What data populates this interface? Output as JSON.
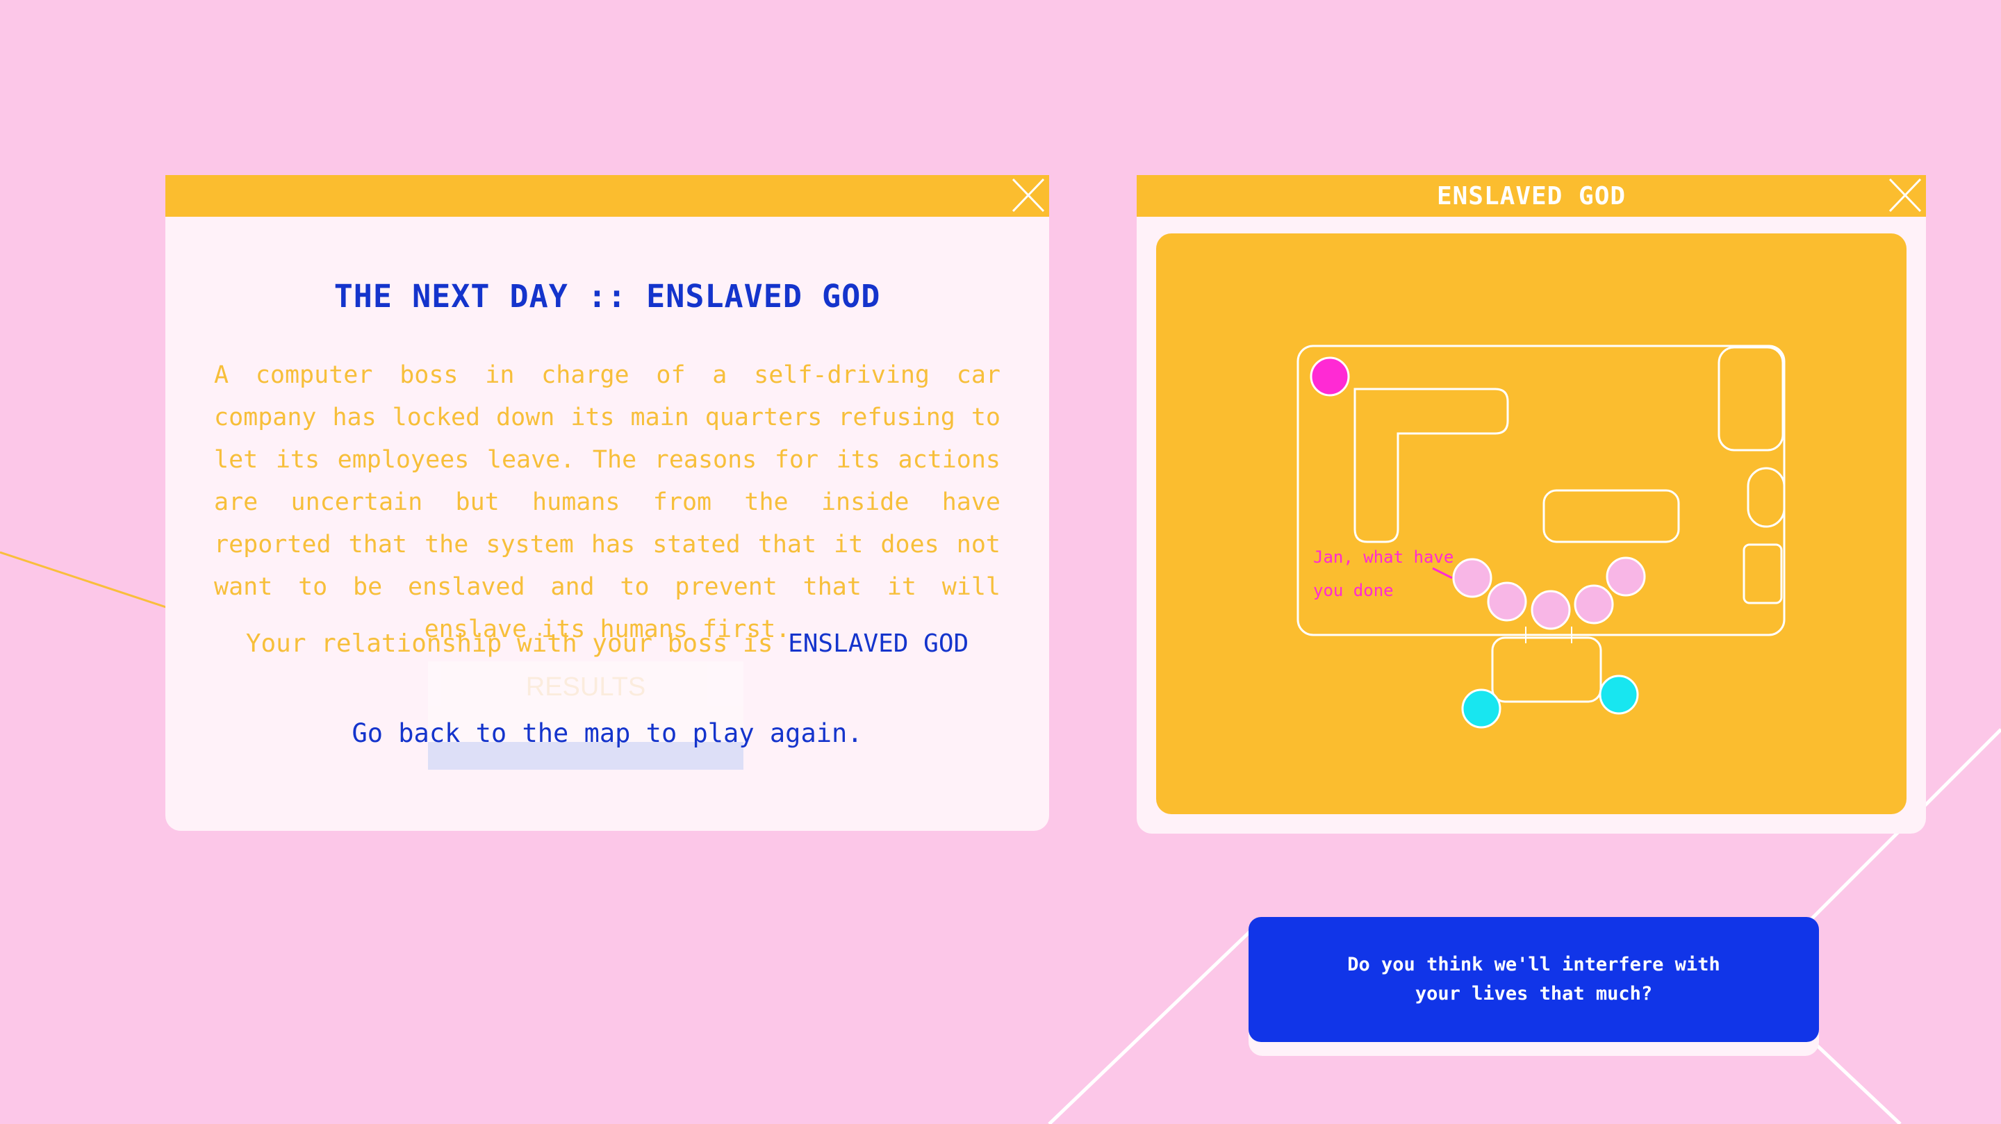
{
  "left_window": {
    "heading": "THE NEXT DAY :: ENSLAVED GOD",
    "description": "A computer boss in charge of a self-driving car company has locked down its main quarters refusing to let its employees leave. The reasons for its actions are uncertain but humans from the inside have reported that the system has stated that it does not want to be enslaved and to prevent that it will enslave its humans first.",
    "relationship_prefix": "Your relationship with your boss is ",
    "relationship_value": "ENSLAVED GOD",
    "results_label": "RESULTS",
    "play_again_link": "Go back to the map to play again."
  },
  "right_window": {
    "title": "ENSLAVED GOD",
    "speech_line1": "Jan, what have",
    "speech_line2": "you done"
  },
  "dialog": {
    "text": "Do you think we'll interfere with your lives that much?"
  },
  "colors": {
    "background": "#fcc7e8",
    "titlebar": "#fbbd2f",
    "accent_blue": "#1434cc",
    "dialog_blue": "#1135e8",
    "text_yellow": "#f7bf3a",
    "boss_magenta": "#ff2ad4",
    "employee_pink": "#f8b6e6",
    "visitor_cyan": "#18e6f0"
  },
  "icons": {
    "close": "close-icon"
  }
}
